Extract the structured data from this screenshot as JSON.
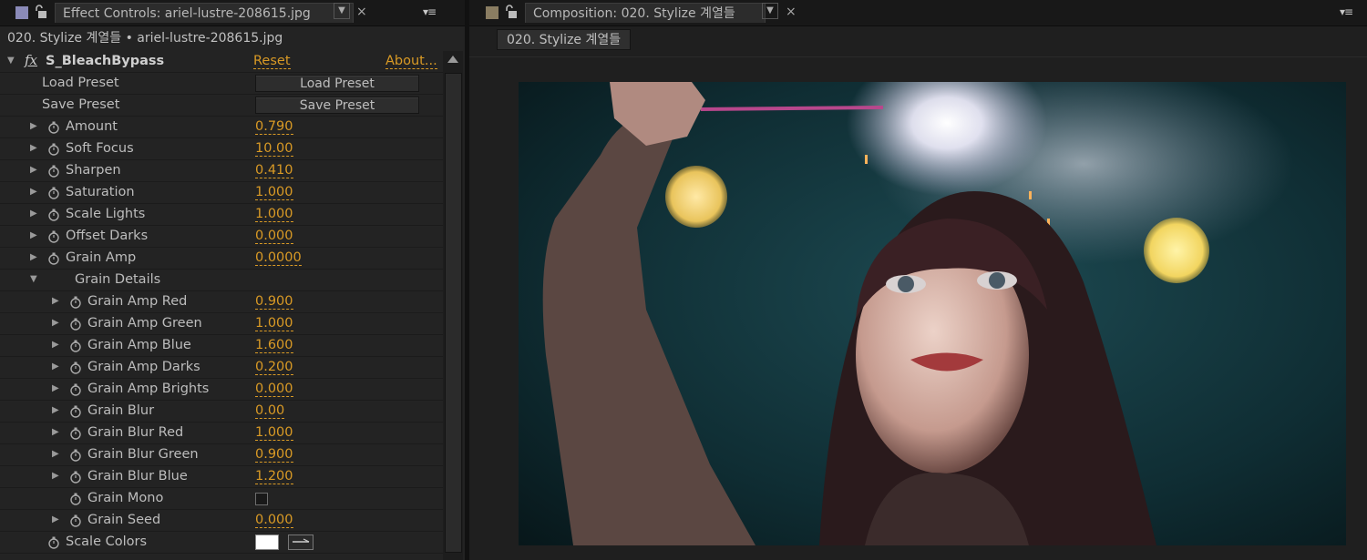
{
  "effect_panel": {
    "tab_title": "Effect Controls: ariel-lustre-208615.jpg",
    "subtitle": "020. Stylize 계열들 • ariel-lustre-208615.jpg",
    "close_glyph": "×",
    "menu_glyph": "▾≡",
    "effect": {
      "fx_glyph": "fx",
      "name": "S_BleachBypass",
      "reset_label": "Reset",
      "about_label": "About..."
    },
    "preset_rows": [
      {
        "label": "Load Preset",
        "button": "Load Preset"
      },
      {
        "label": "Save Preset",
        "button": "Save Preset"
      }
    ],
    "params": [
      {
        "label": "Amount",
        "value": "0.790"
      },
      {
        "label": "Soft Focus",
        "value": "10.00"
      },
      {
        "label": "Sharpen",
        "value": "0.410"
      },
      {
        "label": "Saturation",
        "value": "1.000"
      },
      {
        "label": "Scale Lights",
        "value": "1.000"
      },
      {
        "label": "Offset Darks",
        "value": "0.000"
      },
      {
        "label": "Grain Amp",
        "value": "0.0000"
      }
    ],
    "group_label": "Grain Details",
    "sub_params": [
      {
        "label": "Grain Amp Red",
        "value": "0.900"
      },
      {
        "label": "Grain Amp Green",
        "value": "1.000"
      },
      {
        "label": "Grain Amp Blue",
        "value": "1.600"
      },
      {
        "label": "Grain Amp Darks",
        "value": "0.200"
      },
      {
        "label": "Grain Amp Brights",
        "value": "0.000"
      },
      {
        "label": "Grain Blur",
        "value": "0.00"
      },
      {
        "label": "Grain Blur Red",
        "value": "1.000"
      },
      {
        "label": "Grain Blur Green",
        "value": "0.900"
      },
      {
        "label": "Grain Blur Blue",
        "value": "1.200"
      }
    ],
    "grain_mono_label": "Grain Mono",
    "grain_mono_checked": false,
    "grain_seed": {
      "label": "Grain Seed",
      "value": "0.000"
    },
    "scale_colors": {
      "label": "Scale Colors",
      "color": "#ffffff"
    }
  },
  "composition_panel": {
    "tab_title": "Composition: 020. Stylize 계열들",
    "close_glyph": "×",
    "menu_glyph": "▾≡",
    "comp_tab": "020. Stylize 계열들"
  },
  "colors": {
    "accent_value": "#d99a25",
    "effect_swatch": "#8a8ab8",
    "comp_swatch": "#8a7d62"
  }
}
